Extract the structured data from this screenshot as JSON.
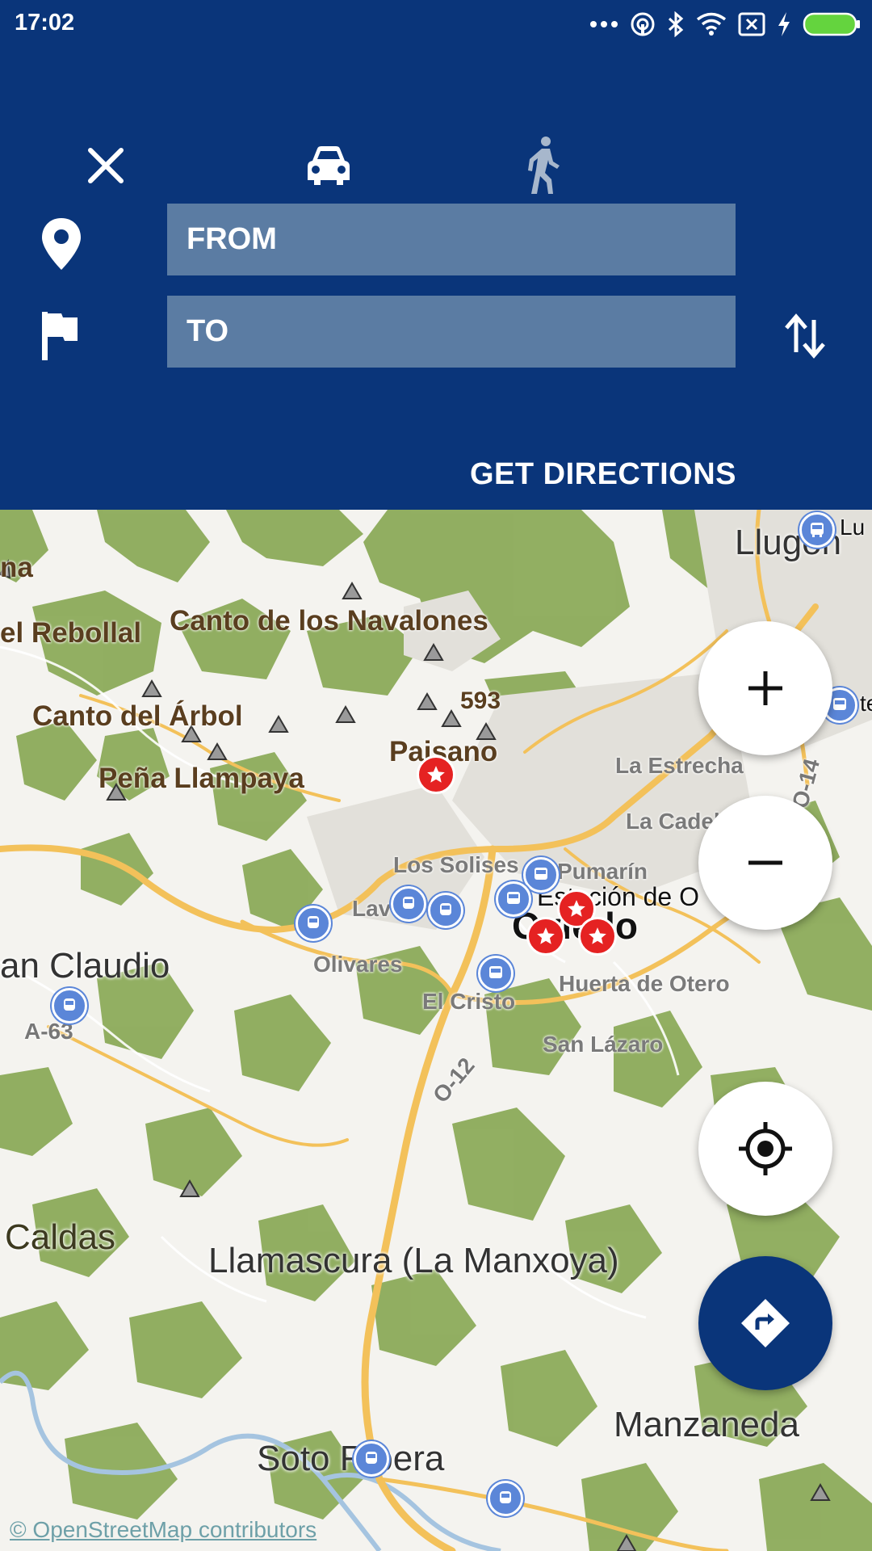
{
  "status_bar": {
    "time": "17:02",
    "icons": [
      "more-icon",
      "hotspot-icon",
      "bluetooth-icon",
      "wifi-icon",
      "no-sim-icon",
      "charging-icon",
      "battery-icon"
    ]
  },
  "header": {
    "close_icon": "close-icon",
    "modes": [
      "car-mode",
      "walk-mode"
    ],
    "from_placeholder": "FROM",
    "to_placeholder": "TO",
    "get_directions": "GET DIRECTIONS"
  },
  "map": {
    "labels": {
      "na": "na",
      "rebollal": "el Rebollal",
      "navalones": "Canto de los Navalones",
      "arbol": "Canto del Árbol",
      "n593": "593",
      "paisano": "Paisano",
      "llampaya": "Peña Llampaya",
      "llugon": "Llugon",
      "lu": "Lu",
      "te": "te",
      "estrecha": "La Estrecha",
      "cadel": "La Cadel",
      "solises": "Los Solises",
      "pumarin": "Pumarín",
      "estacion": "Estación de O",
      "oviedo": "Oviedo",
      "lav": "Lav",
      "olivares": "Olivares",
      "claudio": "an Claudio",
      "elcristo": "El Cristo",
      "huerta": "Huerta de Otero",
      "lazaro": "San Lázaro",
      "a63": "A-63",
      "o12": "O-12",
      "o14": "O-14",
      "caldas": "Caldas",
      "llamascura": "Llamascura (La Manxoya)",
      "manzaneda": "Manzaneda",
      "soto": "Soto Ribera"
    },
    "attribution": "© OpenStreetMap contributors"
  },
  "controls": {
    "zoom_in": "zoom-in-button",
    "zoom_out": "zoom-out-button",
    "locate": "my-location-button",
    "directions": "directions-button"
  },
  "colors": {
    "header": "#0a357a",
    "field": "#5b7ca3",
    "forest": "#8cab5a",
    "road": "#f3c15a",
    "water": "#a5c4e0"
  }
}
